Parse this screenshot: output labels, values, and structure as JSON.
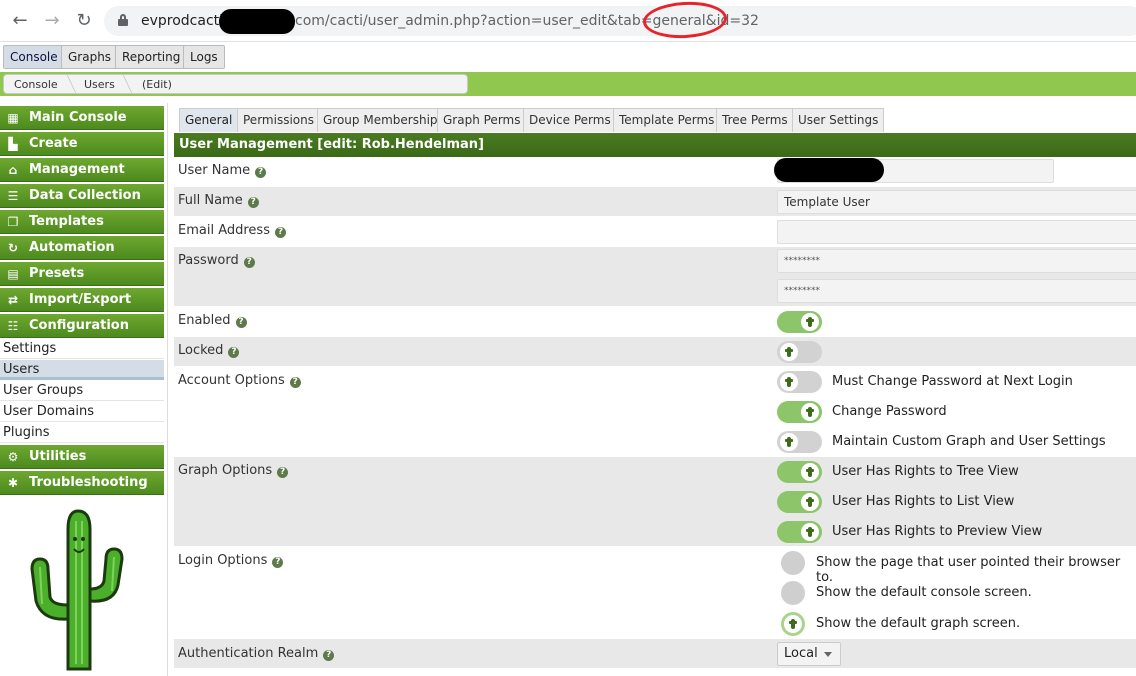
{
  "browser": {
    "url_prefix": "evprodcacti0",
    "url_suffix": "com/cacti/user_admin.php?action=user_edit&tab=general&id=32"
  },
  "top_tabs": [
    "Console",
    "Graphs",
    "Reporting",
    "Logs"
  ],
  "breadcrumb": [
    "Console",
    "Users",
    "(Edit)"
  ],
  "nav": {
    "headers_top": [
      "Main Console",
      "Create",
      "Management",
      "Data Collection",
      "Templates",
      "Automation",
      "Presets",
      "Import/Export",
      "Configuration"
    ],
    "config_items": [
      "Settings",
      "Users",
      "User Groups",
      "User Domains",
      "Plugins"
    ],
    "headers_bottom": [
      "Utilities",
      "Troubleshooting"
    ]
  },
  "subtabs": [
    "General",
    "Permissions",
    "Group Membership",
    "Graph Perms",
    "Device Perms",
    "Template Perms",
    "Tree Perms",
    "User Settings"
  ],
  "form": {
    "title": "User Management [edit: Rob.Hendelman]",
    "user_name_label": "User Name",
    "full_name_label": "Full Name",
    "full_name_value": "Template User",
    "email_label": "Email Address",
    "email_value": "",
    "password_label": "Password",
    "password_value": "********",
    "password_confirm_value": "********",
    "enabled_label": "Enabled",
    "locked_label": "Locked",
    "account_options_label": "Account Options",
    "account_options": [
      {
        "label": "Must Change Password at Next Login",
        "on": false
      },
      {
        "label": "Change Password",
        "on": true
      },
      {
        "label": "Maintain Custom Graph and User Settings",
        "on": false
      }
    ],
    "graph_options_label": "Graph Options",
    "graph_options": [
      {
        "label": "User Has Rights to Tree View",
        "on": true
      },
      {
        "label": "User Has Rights to List View",
        "on": true
      },
      {
        "label": "User Has Rights to Preview View",
        "on": true
      }
    ],
    "login_options_label": "Login Options",
    "login_options": [
      {
        "label": "Show the page that user pointed their browser to.",
        "selected": false
      },
      {
        "label": "Show the default console screen.",
        "selected": false
      },
      {
        "label": "Show the default graph screen.",
        "selected": true
      }
    ],
    "auth_realm_label": "Authentication Realm",
    "auth_realm_value": "Local",
    "enabled_on": true,
    "locked_on": false
  },
  "colors": {
    "accent_green": "#4d8a1e",
    "toggle_on": "#8cc56a",
    "annotation_red": "#e8242b"
  }
}
